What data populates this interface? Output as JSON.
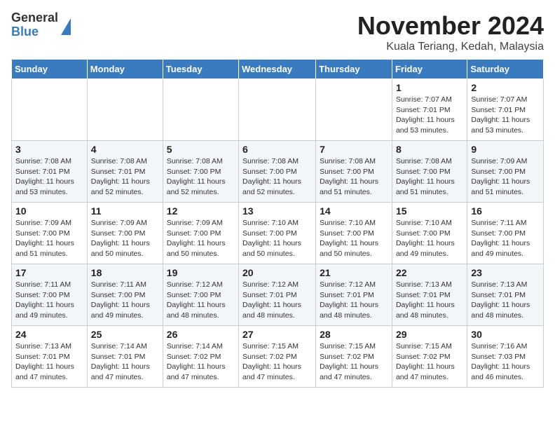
{
  "header": {
    "logo_line1": "General",
    "logo_line2": "Blue",
    "month_title": "November 2024",
    "location": "Kuala Teriang, Kedah, Malaysia"
  },
  "weekdays": [
    "Sunday",
    "Monday",
    "Tuesday",
    "Wednesday",
    "Thursday",
    "Friday",
    "Saturday"
  ],
  "weeks": [
    [
      {
        "day": "",
        "info": ""
      },
      {
        "day": "",
        "info": ""
      },
      {
        "day": "",
        "info": ""
      },
      {
        "day": "",
        "info": ""
      },
      {
        "day": "",
        "info": ""
      },
      {
        "day": "1",
        "info": "Sunrise: 7:07 AM\nSunset: 7:01 PM\nDaylight: 11 hours\nand 53 minutes."
      },
      {
        "day": "2",
        "info": "Sunrise: 7:07 AM\nSunset: 7:01 PM\nDaylight: 11 hours\nand 53 minutes."
      }
    ],
    [
      {
        "day": "3",
        "info": "Sunrise: 7:08 AM\nSunset: 7:01 PM\nDaylight: 11 hours\nand 53 minutes."
      },
      {
        "day": "4",
        "info": "Sunrise: 7:08 AM\nSunset: 7:01 PM\nDaylight: 11 hours\nand 52 minutes."
      },
      {
        "day": "5",
        "info": "Sunrise: 7:08 AM\nSunset: 7:00 PM\nDaylight: 11 hours\nand 52 minutes."
      },
      {
        "day": "6",
        "info": "Sunrise: 7:08 AM\nSunset: 7:00 PM\nDaylight: 11 hours\nand 52 minutes."
      },
      {
        "day": "7",
        "info": "Sunrise: 7:08 AM\nSunset: 7:00 PM\nDaylight: 11 hours\nand 51 minutes."
      },
      {
        "day": "8",
        "info": "Sunrise: 7:08 AM\nSunset: 7:00 PM\nDaylight: 11 hours\nand 51 minutes."
      },
      {
        "day": "9",
        "info": "Sunrise: 7:09 AM\nSunset: 7:00 PM\nDaylight: 11 hours\nand 51 minutes."
      }
    ],
    [
      {
        "day": "10",
        "info": "Sunrise: 7:09 AM\nSunset: 7:00 PM\nDaylight: 11 hours\nand 51 minutes."
      },
      {
        "day": "11",
        "info": "Sunrise: 7:09 AM\nSunset: 7:00 PM\nDaylight: 11 hours\nand 50 minutes."
      },
      {
        "day": "12",
        "info": "Sunrise: 7:09 AM\nSunset: 7:00 PM\nDaylight: 11 hours\nand 50 minutes."
      },
      {
        "day": "13",
        "info": "Sunrise: 7:10 AM\nSunset: 7:00 PM\nDaylight: 11 hours\nand 50 minutes."
      },
      {
        "day": "14",
        "info": "Sunrise: 7:10 AM\nSunset: 7:00 PM\nDaylight: 11 hours\nand 50 minutes."
      },
      {
        "day": "15",
        "info": "Sunrise: 7:10 AM\nSunset: 7:00 PM\nDaylight: 11 hours\nand 49 minutes."
      },
      {
        "day": "16",
        "info": "Sunrise: 7:11 AM\nSunset: 7:00 PM\nDaylight: 11 hours\nand 49 minutes."
      }
    ],
    [
      {
        "day": "17",
        "info": "Sunrise: 7:11 AM\nSunset: 7:00 PM\nDaylight: 11 hours\nand 49 minutes."
      },
      {
        "day": "18",
        "info": "Sunrise: 7:11 AM\nSunset: 7:00 PM\nDaylight: 11 hours\nand 49 minutes."
      },
      {
        "day": "19",
        "info": "Sunrise: 7:12 AM\nSunset: 7:00 PM\nDaylight: 11 hours\nand 48 minutes."
      },
      {
        "day": "20",
        "info": "Sunrise: 7:12 AM\nSunset: 7:01 PM\nDaylight: 11 hours\nand 48 minutes."
      },
      {
        "day": "21",
        "info": "Sunrise: 7:12 AM\nSunset: 7:01 PM\nDaylight: 11 hours\nand 48 minutes."
      },
      {
        "day": "22",
        "info": "Sunrise: 7:13 AM\nSunset: 7:01 PM\nDaylight: 11 hours\nand 48 minutes."
      },
      {
        "day": "23",
        "info": "Sunrise: 7:13 AM\nSunset: 7:01 PM\nDaylight: 11 hours\nand 48 minutes."
      }
    ],
    [
      {
        "day": "24",
        "info": "Sunrise: 7:13 AM\nSunset: 7:01 PM\nDaylight: 11 hours\nand 47 minutes."
      },
      {
        "day": "25",
        "info": "Sunrise: 7:14 AM\nSunset: 7:01 PM\nDaylight: 11 hours\nand 47 minutes."
      },
      {
        "day": "26",
        "info": "Sunrise: 7:14 AM\nSunset: 7:02 PM\nDaylight: 11 hours\nand 47 minutes."
      },
      {
        "day": "27",
        "info": "Sunrise: 7:15 AM\nSunset: 7:02 PM\nDaylight: 11 hours\nand 47 minutes."
      },
      {
        "day": "28",
        "info": "Sunrise: 7:15 AM\nSunset: 7:02 PM\nDaylight: 11 hours\nand 47 minutes."
      },
      {
        "day": "29",
        "info": "Sunrise: 7:15 AM\nSunset: 7:02 PM\nDaylight: 11 hours\nand 47 minutes."
      },
      {
        "day": "30",
        "info": "Sunrise: 7:16 AM\nSunset: 7:03 PM\nDaylight: 11 hours\nand 46 minutes."
      }
    ]
  ]
}
